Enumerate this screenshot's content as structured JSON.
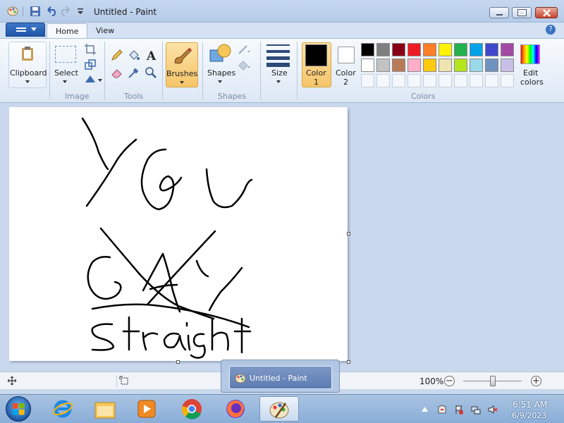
{
  "window": {
    "title": "Untitled - Paint"
  },
  "ribbon": {
    "tabs": [
      "Home",
      "View"
    ],
    "groups": {
      "clipboard": {
        "label": "Clipboard"
      },
      "image": {
        "label": "Image",
        "select_label": "Select"
      },
      "tools": {
        "label": "Tools"
      },
      "brushes": {
        "label": "Brushes"
      },
      "shapes": {
        "label": "Shapes",
        "shapes_button": "Shapes"
      },
      "size": {
        "label": "Size"
      },
      "color1": {
        "label": "Color",
        "sub": "1"
      },
      "color2": {
        "label": "Color",
        "sub": "2"
      },
      "colors": {
        "label": "Colors",
        "edit_label": "Edit",
        "edit_sub": "colors"
      }
    },
    "palette_row1": [
      "#000000",
      "#7f7f7f",
      "#880015",
      "#ed1c24",
      "#ff7f27",
      "#fff200",
      "#22b14c",
      "#00a2e8",
      "#3f48cc",
      "#a349a4"
    ],
    "palette_row2": [
      "#ffffff",
      "#c3c3c3",
      "#b97a57",
      "#ffaec9",
      "#ffc90e",
      "#efe4b0",
      "#b5e61d",
      "#99d9ea",
      "#7092be",
      "#c8bfe7"
    ],
    "color1_value": "#000000",
    "color2_value": "#ffffff"
  },
  "statusbar": {
    "zoom": "100%",
    "zoom_fraction": 0.5
  },
  "popup": {
    "title": "Untitled - Paint"
  },
  "taskbar": {
    "apps": [
      "internet-explorer",
      "file-explorer",
      "media-player",
      "chrome",
      "firefox",
      "paint"
    ],
    "time": "6:51 AM",
    "date": "6/9/2023"
  },
  "accent": "#1f56a8"
}
